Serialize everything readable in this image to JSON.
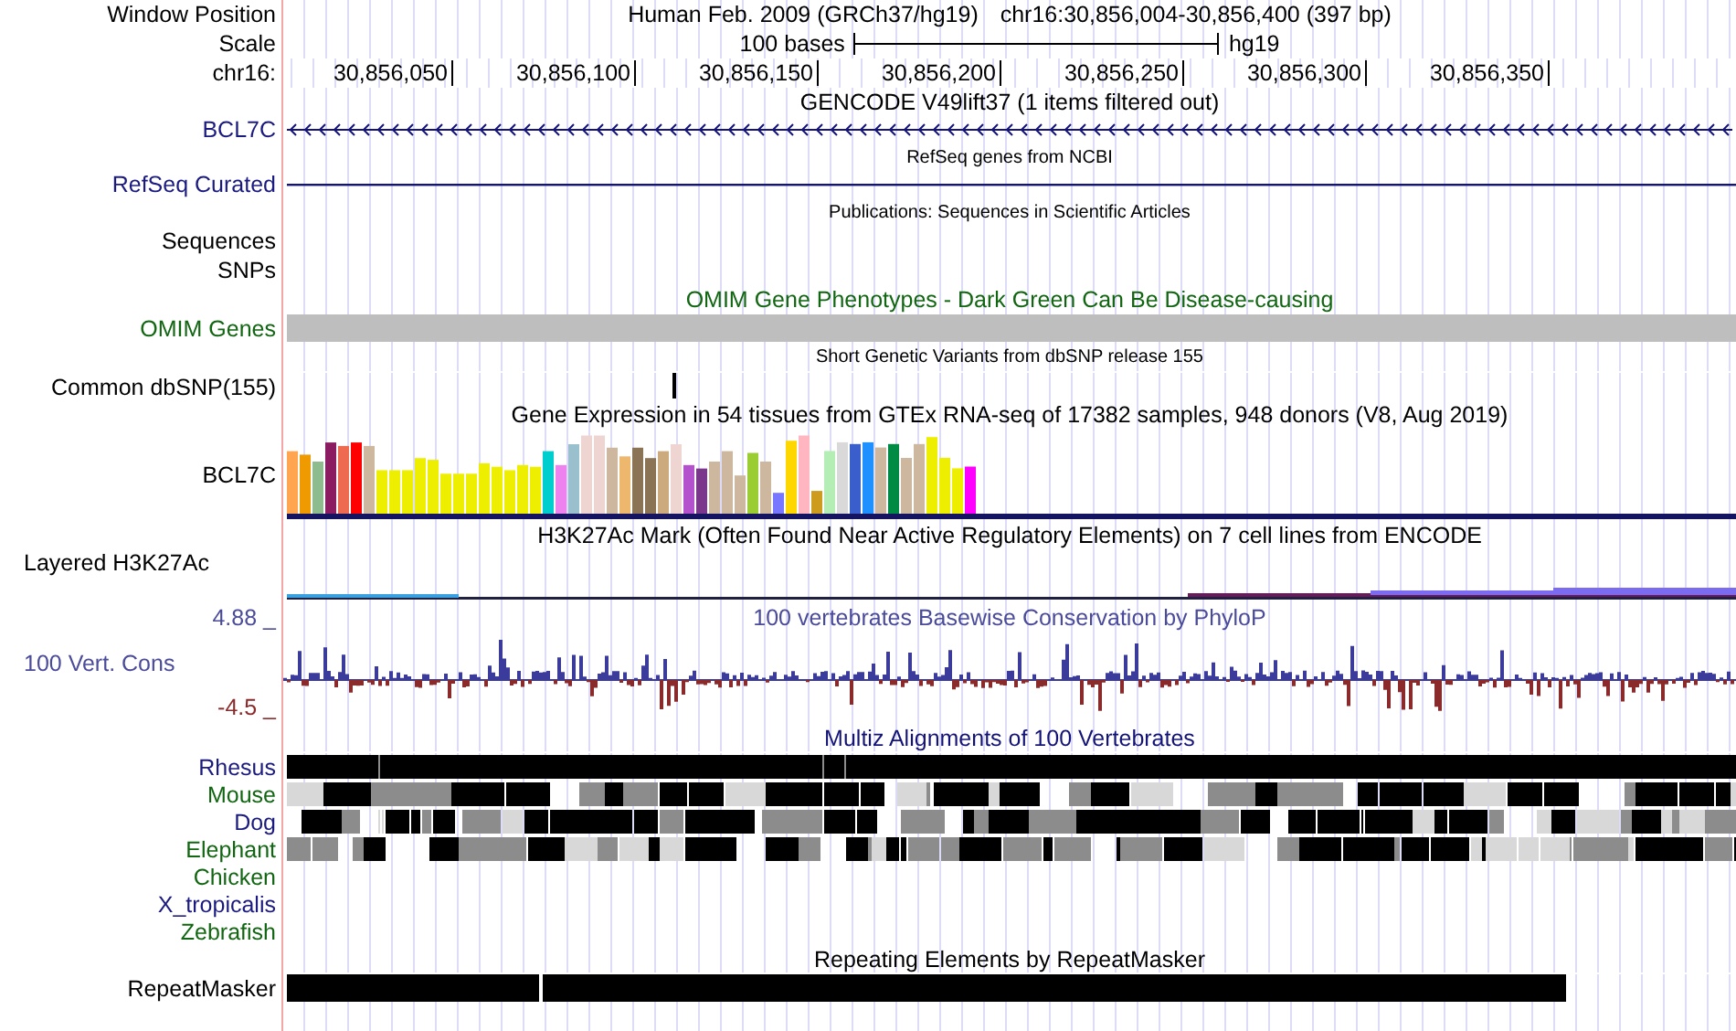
{
  "header": {
    "position_label": "Window Position",
    "assembly_name": "Human Feb. 2009 (GRCh37/hg19)",
    "position": "chr16:30,856,004-30,856,400 (397 bp)",
    "scale_label": "Scale",
    "scale_text": "100 bases",
    "scale_assembly": "hg19",
    "chrom_label": "chr16:",
    "ticks": [
      "30,856,050",
      "30,856,100",
      "30,856,150",
      "30,856,200",
      "30,856,250",
      "30,856,300",
      "30,856,350"
    ]
  },
  "tracks": [
    {
      "kind": "gene",
      "title": "GENCODE V49lift37 (1 items filtered out)",
      "label": "BCL7C"
    },
    {
      "kind": "refseq",
      "title": "RefSeq genes from NCBI",
      "label": "RefSeq Curated"
    },
    {
      "kind": "publications",
      "title": "Publications: Sequences in Scientific Articles",
      "label": "Sequences"
    },
    {
      "kind": "composite",
      "label": "SNPs"
    },
    {
      "kind": "omim",
      "title": "OMIM Gene Phenotypes - Dark Green Can Be Disease-causing",
      "label": "OMIM Genes"
    },
    {
      "kind": "snp",
      "title": "Short Genetic Variants from dbSNP release 155",
      "label": "Common dbSNP(155)"
    },
    {
      "kind": "gtex",
      "title": "Gene Expression in 54 tissues from GTEx RNA-seq of 17382 samples, 948 donors (V8, Aug 2019)",
      "label": "BCL7C"
    },
    {
      "kind": "h3k27ac",
      "title": "H3K27Ac Mark (Often Found Near Active Regulatory Elements) on 7 cell lines from ENCODE",
      "label": "Layered H3K27Ac"
    },
    {
      "kind": "phylop",
      "title": "100 vertebrates Basewise Conservation by PhyloP",
      "label": "100 Vert. Cons",
      "max": "4.88 _",
      "min": "-4.5 _"
    },
    {
      "kind": "multiz",
      "title": "Multiz Alignments of 100 Vertebrates",
      "species": [
        {
          "name": "Rhesus",
          "color": "#1a1a80",
          "aligned": true
        },
        {
          "name": "Mouse",
          "color": "#116611",
          "aligned": true
        },
        {
          "name": "Dog",
          "color": "#1a1a80",
          "aligned": true
        },
        {
          "name": "Elephant",
          "color": "#116611",
          "aligned": true
        },
        {
          "name": "Chicken",
          "color": "#116611",
          "aligned": false
        },
        {
          "name": "X_tropicalis",
          "color": "#1a1a80",
          "aligned": false
        },
        {
          "name": "Zebrafish",
          "color": "#116611",
          "aligned": false
        }
      ]
    },
    {
      "kind": "repeat",
      "title": "Repeating Elements by RepeatMasker",
      "label": "RepeatMasker"
    }
  ]
}
